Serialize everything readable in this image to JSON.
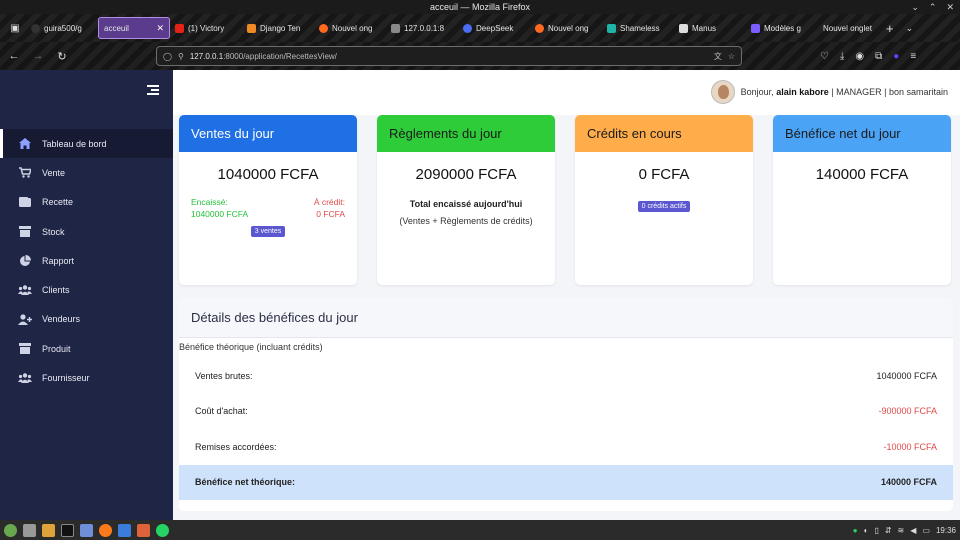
{
  "window": {
    "title": "acceuil — Mozilla Firefox"
  },
  "tabs": [
    {
      "label": "guira500/g",
      "color": "#333333"
    },
    {
      "label": "acceuil",
      "color": "#5a3b8c",
      "active": true
    },
    {
      "label": "(1) Victory",
      "color": "#e62117"
    },
    {
      "label": "Django Ten",
      "color": "#f08a24"
    },
    {
      "label": "Nouvel ong",
      "color": "#ff6a1f"
    },
    {
      "label": "127.0.0.1:8",
      "color": "#888888"
    },
    {
      "label": "DeepSeek",
      "color": "#4b6cf5"
    },
    {
      "label": "Nouvel ong",
      "color": "#ff6a1f"
    },
    {
      "label": "Shameless",
      "color": "#1fb3a8"
    },
    {
      "label": "Manus",
      "color": "#222222"
    },
    {
      "label": "Modèles g",
      "color": "#7c5cff"
    },
    {
      "label": "Nouvel onglet",
      "color": "#555555"
    }
  ],
  "url": {
    "host": "127.0.0.1",
    "rest": ":8000/application/RecettesView/"
  },
  "sidebar": {
    "items": [
      {
        "label": "Tableau de bord",
        "icon": "home-icon",
        "active": true
      },
      {
        "label": "Vente",
        "icon": "cart-icon"
      },
      {
        "label": "Recette",
        "icon": "wallet-icon"
      },
      {
        "label": "Stock",
        "icon": "box-icon"
      },
      {
        "label": "Rapport",
        "icon": "pie-chart-icon"
      },
      {
        "label": "Clients",
        "icon": "users-icon"
      },
      {
        "label": "Vendeurs",
        "icon": "user-plus-icon"
      },
      {
        "label": "Produit",
        "icon": "box-icon"
      },
      {
        "label": "Fournisseur",
        "icon": "users-icon"
      }
    ]
  },
  "user": {
    "greeting": "Bonjour,",
    "name": "alain kabore",
    "role": "| MANAGER |",
    "shop": "bon samaritain"
  },
  "cards": {
    "ventes": {
      "title": "Ventes du jour",
      "amount": "1040000 FCFA",
      "encaisse_label": "Encaissé:",
      "encaisse_value": "1040000 FCFA",
      "credit_label": "À crédit:",
      "credit_value": "0 FCFA",
      "badge": "3 ventes",
      "color": "#1f6fe5"
    },
    "reglements": {
      "title": "Règlements du jour",
      "amount": "2090000 FCFA",
      "total_label": "Total encaissé aujourd'hui",
      "note": "(Ventes + Règlements de crédits)",
      "color": "#2fcc3a"
    },
    "credits": {
      "title": "Crédits en cours",
      "amount": "0 FCFA",
      "badge": "0 crédits actifs",
      "color": "#ffac4a"
    },
    "benefice": {
      "title": "Bénéfice net du jour",
      "amount": "140000 FCFA",
      "color": "#4ba3f5"
    }
  },
  "details": {
    "title": "Détails des bénéfices du jour",
    "subtitle": "Bénéfice théorique (incluant crédits)",
    "rows": [
      {
        "label": "Ventes brutes:",
        "value": "1040000 FCFA"
      },
      {
        "label": "Coût d'achat:",
        "value": "-900000 FCFA"
      },
      {
        "label": "Remises accordées:",
        "value": "-10000 FCFA"
      },
      {
        "label": "Bénéfice net théorique:",
        "value": "140000 FCFA"
      }
    ]
  },
  "taskbar": {
    "time": "19:36"
  }
}
